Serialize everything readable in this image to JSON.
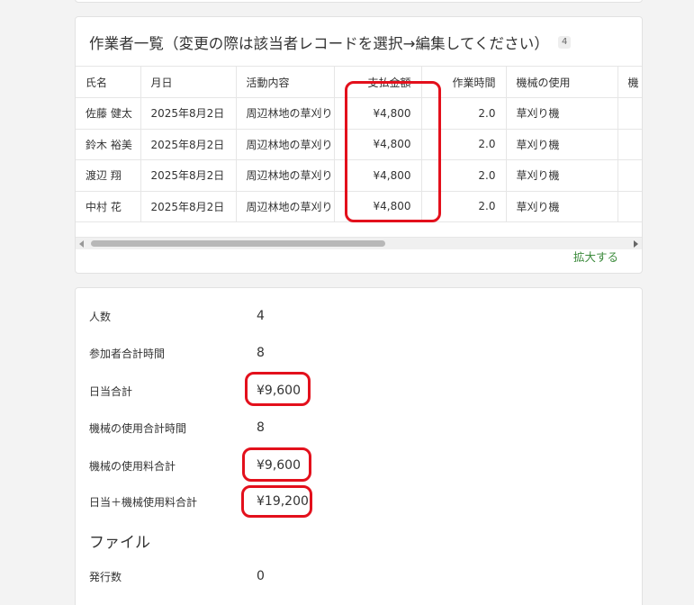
{
  "list": {
    "title": "作業者一覧（変更の際は該当者レコードを選択→編集してください）",
    "count": "4",
    "columns": [
      "氏名",
      "月日",
      "活動内容",
      "支払金額",
      "作業時間",
      "機械の使用",
      "機"
    ],
    "rows": [
      [
        "佐藤 健太",
        "2025年8月2日",
        "周辺林地の草刈り",
        "¥4,800",
        "2.0",
        "草刈り機",
        ""
      ],
      [
        "鈴木 裕美",
        "2025年8月2日",
        "周辺林地の草刈り",
        "¥4,800",
        "2.0",
        "草刈り機",
        ""
      ],
      [
        "渡辺 翔",
        "2025年8月2日",
        "周辺林地の草刈り",
        "¥4,800",
        "2.0",
        "草刈り機",
        ""
      ],
      [
        "中村 花",
        "2025年8月2日",
        "周辺林地の草刈り",
        "¥4,800",
        "2.0",
        "草刈り機",
        ""
      ]
    ],
    "expand_label": "拡大する"
  },
  "summary": {
    "people_label": "人数",
    "people_value": "4",
    "total_hours_label": "参加者合計時間",
    "total_hours_value": "8",
    "daily_total_label": "日当合計",
    "daily_total_value": "¥9,600",
    "machine_hours_label": "機械の使用合計時間",
    "machine_hours_value": "8",
    "machine_fee_label": "機械の使用料合計",
    "machine_fee_value": "¥9,600",
    "grand_total_label": "日当＋機械使用料合計",
    "grand_total_value": "¥19,200"
  },
  "file_section": {
    "title": "ファイル",
    "issued_label": "発行数",
    "issued_value": "0"
  },
  "colors": {
    "annotation": "#e3101c",
    "link": "#3d8b3d"
  }
}
